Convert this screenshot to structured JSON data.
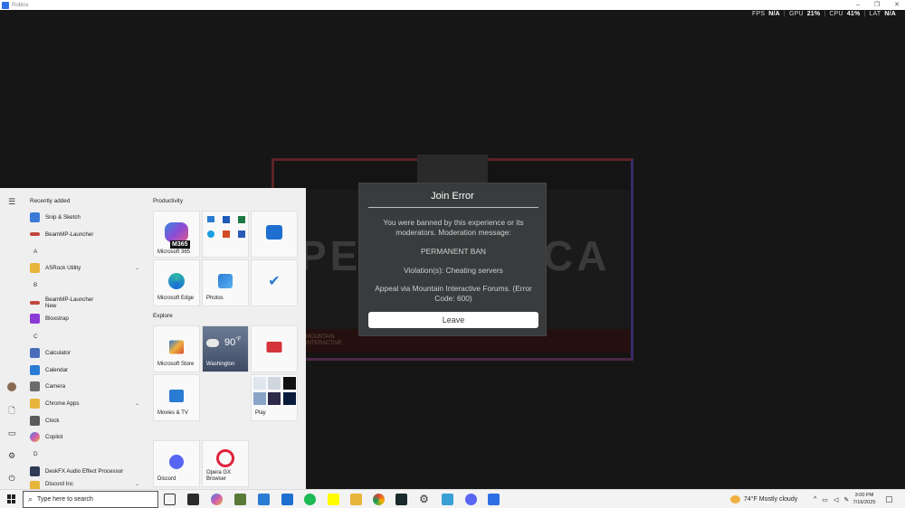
{
  "window": {
    "title": "Roblox",
    "controls": [
      "–",
      "❐",
      "✕"
    ]
  },
  "stats": [
    {
      "label": "FPS",
      "value": "N/A"
    },
    {
      "label": "GPU",
      "value": "21%"
    },
    {
      "label": "CPU",
      "value": "41%"
    },
    {
      "label": "LAT",
      "value": "N/A"
    }
  ],
  "banner": {
    "left_text": "PE",
    "right_text": "CA",
    "strip_text": "MOUNTAIN INTERACTIVE"
  },
  "dialog": {
    "title": "Join Error",
    "message": "You were banned by this experience or its moderators. Moderation message:",
    "ban_type": "PERMANENT BAN",
    "violations": "Violation(s): Cheating servers",
    "appeal": "Appeal via Mountain Interactive Forums. (Error Code: 600)",
    "leave_label": "Leave"
  },
  "startmenu": {
    "recently_added_label": "Recently added",
    "recent": [
      {
        "label": "Snip & Sketch",
        "color": "#3b7ad6"
      },
      {
        "label": "BeamMP-Launcher",
        "color": "#c0463c"
      }
    ],
    "letters": [
      "A",
      "B",
      "C",
      "D"
    ],
    "apps_a": [
      {
        "label": "ASRock Utility",
        "color": "#e8b53b"
      }
    ],
    "apps_b": [
      {
        "label": "BeamMP-Launcher",
        "sub": "New",
        "color": "#c0463c"
      },
      {
        "label": "Bloxstrap",
        "color": "#8a3bd6"
      }
    ],
    "apps_c": [
      {
        "label": "Calculator",
        "color": "#4a6dbb"
      },
      {
        "label": "Calendar",
        "color": "#2a7bd3"
      },
      {
        "label": "Camera",
        "color": "#6c6c6c"
      },
      {
        "label": "Chrome Apps",
        "color": "#e8b53b"
      },
      {
        "label": "Clock",
        "color": "#5b5b5b"
      },
      {
        "label": "Copilot",
        "color": "#d05bb0"
      }
    ],
    "apps_d": [
      {
        "label": "DeskFX Audio Effect Processor",
        "color": "#2f3b55"
      },
      {
        "label": "Discord Inc",
        "color": "#e8b53b"
      }
    ],
    "groups": [
      "Productivity",
      "Explore"
    ],
    "tiles": {
      "m365": {
        "label": "Microsoft 365",
        "badge": "M365"
      },
      "edge": {
        "label": "Microsoft Edge"
      },
      "photos": {
        "label": "Photos"
      },
      "store": {
        "label": "Microsoft Store"
      },
      "weather": {
        "label": "Washington",
        "temp": "90",
        "unit": "°F"
      },
      "movies": {
        "label": "Movies & TV"
      },
      "play": {
        "label": "Play"
      },
      "discord": {
        "label": "Discord"
      },
      "opera": {
        "label": "Opera GX Browser"
      }
    }
  },
  "taskbar": {
    "search_placeholder": "Type here to search",
    "weather": "74°F  Mostly cloudy",
    "time": "3:00 PM",
    "date": "7/16/2025"
  }
}
